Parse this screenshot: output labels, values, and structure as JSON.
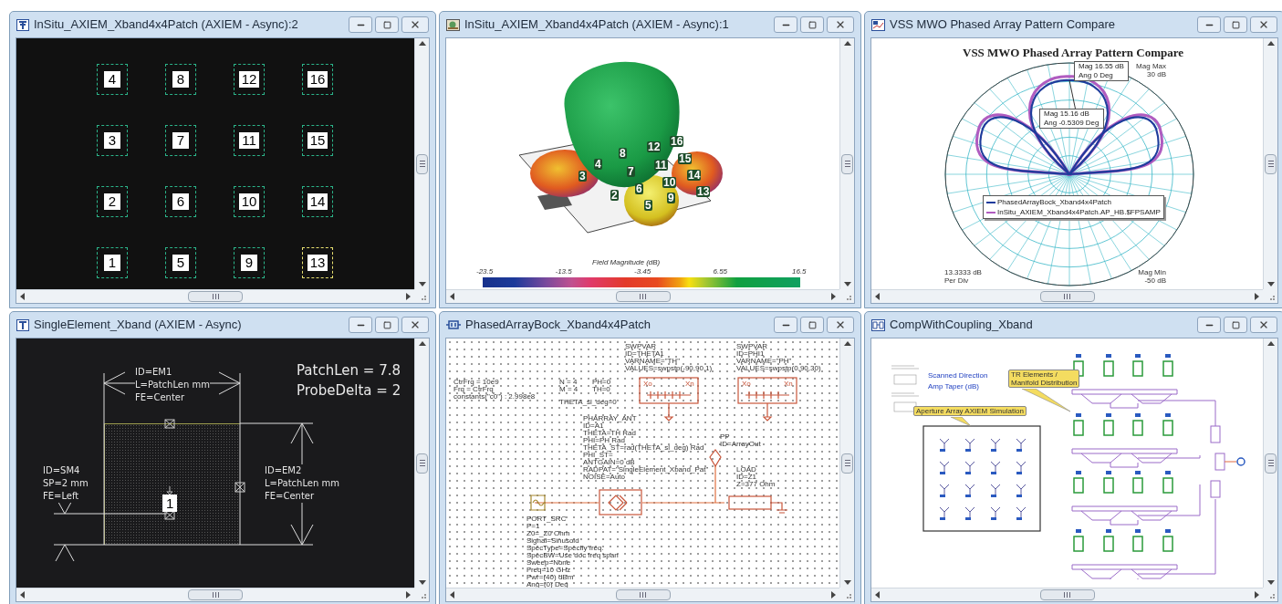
{
  "windows": [
    {
      "kind": "layout",
      "title": "InSitu_AXIEM_Xband4x4Patch (AXIEM - Async):2",
      "patch_rows": [
        [
          {
            "label": "4",
            "selected": false
          },
          {
            "label": "8",
            "selected": false
          },
          {
            "label": "12",
            "selected": false
          },
          {
            "label": "16",
            "selected": false
          }
        ],
        [
          {
            "label": "3",
            "selected": false
          },
          {
            "label": "7",
            "selected": false
          },
          {
            "label": "11",
            "selected": false
          },
          {
            "label": "15",
            "selected": false
          }
        ],
        [
          {
            "label": "2",
            "selected": false
          },
          {
            "label": "6",
            "selected": false
          },
          {
            "label": "10",
            "selected": false
          },
          {
            "label": "14",
            "selected": false
          }
        ],
        [
          {
            "label": "1",
            "selected": false
          },
          {
            "label": "5",
            "selected": false
          },
          {
            "label": "9",
            "selected": false
          },
          {
            "label": "13",
            "selected": true
          }
        ]
      ]
    },
    {
      "kind": "pattern3d",
      "title": "InSitu_AXIEM_Xband4x4Patch (AXIEM - Async):1",
      "element_labels": [
        "8",
        "12",
        "16",
        "4",
        "3",
        "7",
        "11",
        "15",
        "2",
        "6",
        "10",
        "14",
        "5",
        "9",
        "13"
      ],
      "colorbar": {
        "title": "Field Magnitude (dB)",
        "ticks": [
          "-23.5",
          "-13.5",
          "-3.45",
          "6.55",
          "16.5"
        ]
      }
    },
    {
      "kind": "polar",
      "title": "VSS MWO Phased Array Pattern Compare",
      "chart_title": "VSS MWO Phased Array Pattern Compare",
      "markers": [
        "Mag 16.55 dB\nAng 0 Deg",
        "Mag 15.16 dB\nAng -0.5309 Deg"
      ],
      "legend": [
        {
          "name": "PhasedArrayBock_Xband4x4Patch",
          "color": "#1f3c9c"
        },
        {
          "name": "InSitu_AXIEM_Xband4x4Patch.AP_HB.$FPSAMP",
          "color": "#b05cc0"
        }
      ],
      "corner_notes": [
        "Mag Max\n30 dB",
        "13.3333 dB\nPer Div",
        "Mag Min\n-50 dB"
      ]
    },
    {
      "kind": "single",
      "title": "SingleElement_Xband (AXIEM - Async)",
      "equations": [
        "PatchLen = 7.8",
        "ProbeDelta = 2"
      ],
      "annotations": [
        "ID=EM1\nL=PatchLen mm\nFE=Center",
        "ID=SM4\nSP=2 mm\nFE=Left",
        "ID=EM2\nL=PatchLen mm\nFE=Center"
      ],
      "port_label": "1"
    },
    {
      "kind": "schematic",
      "title": "PhasedArrayBock_Xband4x4Patch",
      "blocks": [
        "CtrFrq = 10e9\nFrq = CtrFrq\nconstants(\"c0\") : 2.998e8",
        "N = 4\nM = 4",
        "PH=0\nTH=0",
        "THETA_sl_deg=0",
        "SWPVAR\nID=THETA1\nVARNAME=\"TH\"\nVALUES=swpstp(-90,90,1)",
        "SWPVAR\nID=PHI1\nVARNAME=\"PH\"\nVALUES=swpstp(0,90,30)",
        "PHARRAY_ANT\nID=A1\nTHETA=TH Rad\nPHI=PH Rad\nTHETA_ST=rad(THETA_sl_deg) Rad\nPHI_ST=\nANTGAIN=0 dB\nRADPAT=\"SingleElement_Xband_Pat\"\nNOISE=Auto",
        "PP\nID=ArrayOut",
        "LOAD\nID=Z1\nZ=377 Ohm",
        "PORT_SRC\nP=1\nZ0=_Z0 Ohm\nSignal=Sinusoid\nSpecType=Specify freq.\nSpecBW=Use doc freq span\nSweep=None\nFreq=10 GHz\nPwr=(40) dBm\nAng=(0) Deg"
      ],
      "sweep_boxes": [
        {
          "start": "Xo",
          "end": "Xn"
        },
        {
          "start": "Xo",
          "end": "Xn"
        }
      ]
    },
    {
      "kind": "system",
      "title": "CompWithCoupling_Xband",
      "notes": [
        "Scanned Direction",
        "Amp Taper (dB)"
      ],
      "callouts": [
        "TR Elements /\nManifold Distribution",
        "Aperture Array AXIEM Simulation"
      ]
    }
  ]
}
